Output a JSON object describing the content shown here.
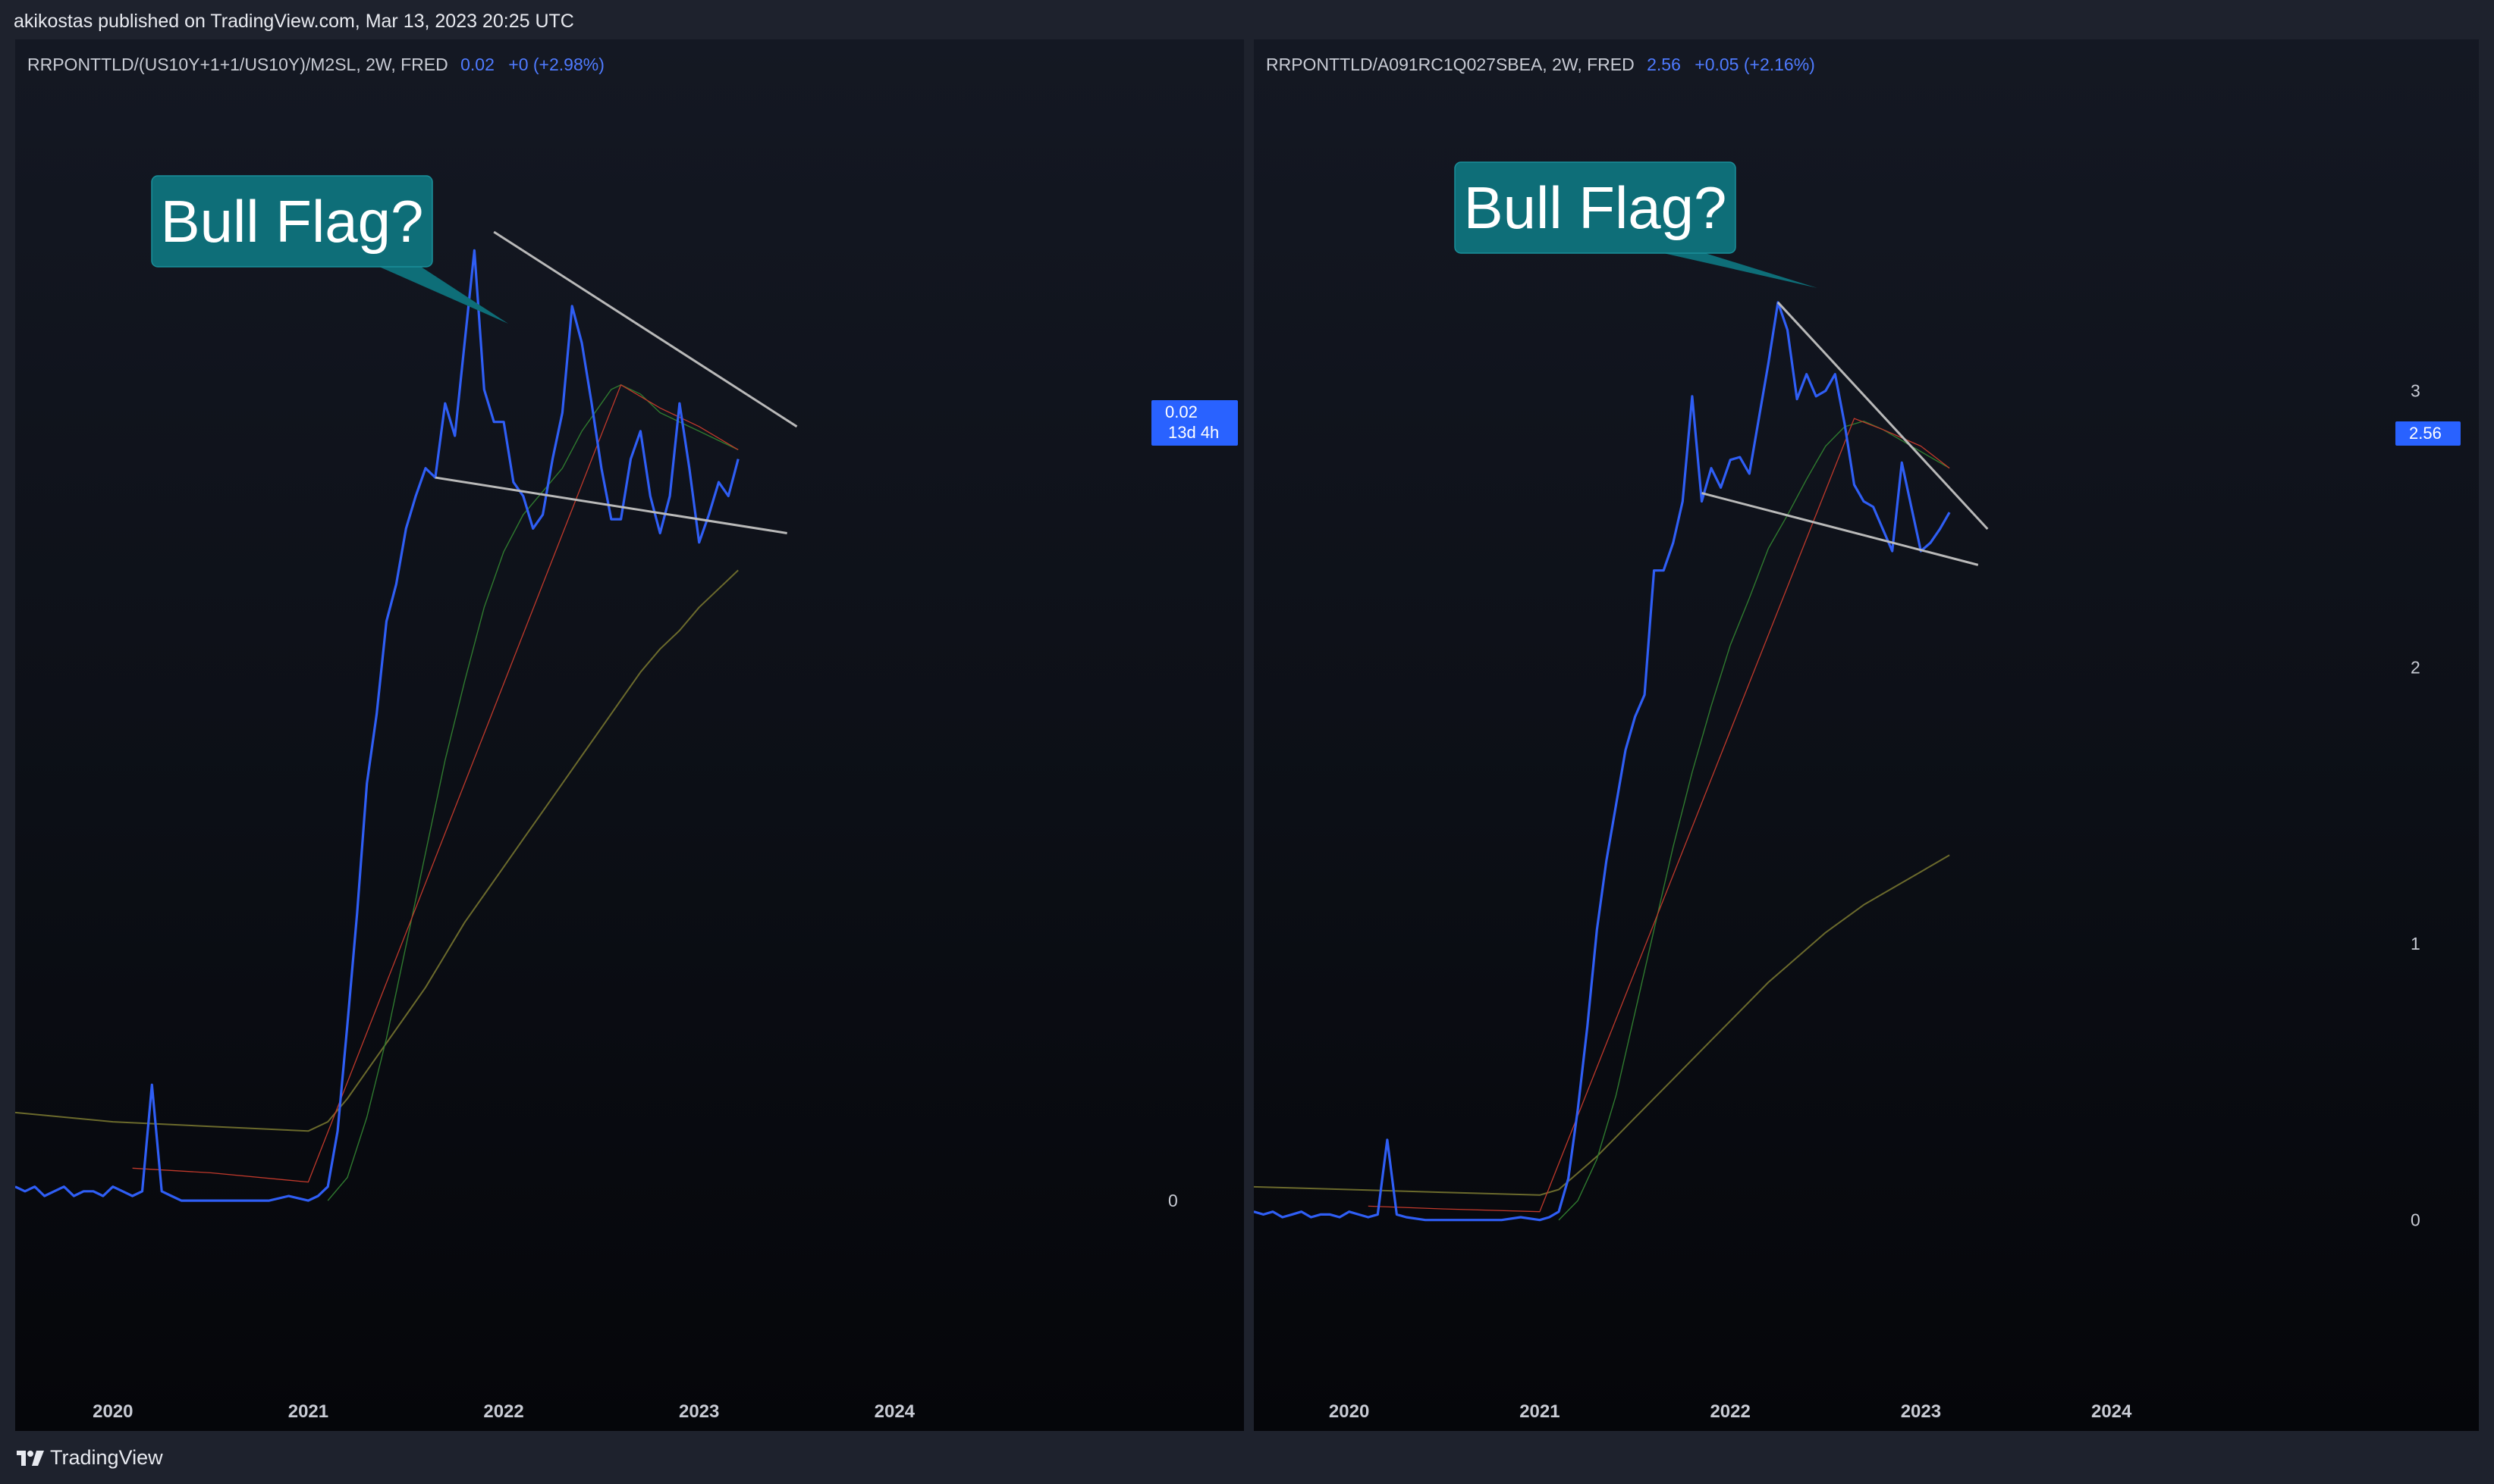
{
  "header": {
    "publisher": "akikostas published on TradingView.com, Mar 13, 2023 20:25 UTC"
  },
  "footer": {
    "brand": "TradingView",
    "icon": "tradingview-logo-icon"
  },
  "colors": {
    "price": "#2f5ef5",
    "ma_fast": "#2f7a2f",
    "ma_slow": "#6b6a2c",
    "ma_red": "#c0392b",
    "trendline": "#b9b9b9",
    "callout": "#0e6e78",
    "badge": "#2962ff"
  },
  "panes": [
    {
      "legend": {
        "symbol": "RRPONTTLD/(US10Y+1+1/US10Y)/M2SL, 2W, FRED",
        "value": "0.02",
        "change": "+0 (+2.98%)"
      },
      "callout": "Bull Flag?",
      "price_badge": {
        "value": "0.02",
        "countdown": "13d 4h"
      }
    },
    {
      "legend": {
        "symbol": "RRPONTTLD/A091RC1Q027SBEA, 2W, FRED",
        "value": "2.56",
        "change": "+0.05 (+2.16%)"
      },
      "callout": "Bull Flag?",
      "price_badge": {
        "value": "2.56"
      }
    }
  ],
  "chart_data": [
    {
      "type": "line",
      "title": "RRPONTTLD/(US10Y+1+1/US10Y)/M2SL, 2W, FRED",
      "x_ticks": [
        "2020",
        "2021",
        "2022",
        "2023",
        "2024"
      ],
      "y_ticks": [
        "0"
      ],
      "xlim": [
        2019.5,
        2025.4
      ],
      "ylim": [
        -0.0034,
        0.0226
      ],
      "series": [
        {
          "role": "price",
          "x": [
            2019.5,
            2019.55,
            2019.6,
            2019.65,
            2019.7,
            2019.75,
            2019.8,
            2019.85,
            2019.9,
            2019.95,
            2020.0,
            2020.05,
            2020.1,
            2020.15,
            2020.2,
            2020.25,
            2020.3,
            2020.35,
            2020.4,
            2020.5,
            2020.6,
            2020.7,
            2020.8,
            2020.9,
            2021.0,
            2021.05,
            2021.1,
            2021.15,
            2021.2,
            2021.25,
            2021.3,
            2021.35,
            2021.4,
            2021.45,
            2021.5,
            2021.55,
            2021.6,
            2021.65,
            2021.7,
            2021.75,
            2021.8,
            2021.85,
            2021.9,
            2021.95,
            2022.0,
            2022.05,
            2022.1,
            2022.15,
            2022.2,
            2022.25,
            2022.3,
            2022.35,
            2022.4,
            2022.45,
            2022.5,
            2022.55,
            2022.6,
            2022.65,
            2022.7,
            2022.75,
            2022.8,
            2022.85,
            2022.9,
            2022.95,
            2023.0,
            2023.05,
            2023.1,
            2023.15,
            2023.2
          ],
          "y": [
            0.0003,
            0.0002,
            0.0003,
            0.0001,
            0.0002,
            0.0003,
            0.0001,
            0.0002,
            0.0002,
            0.0001,
            0.0003,
            0.0002,
            0.0001,
            0.0002,
            0.0025,
            0.0002,
            0.0001,
            0.0,
            0.0,
            0.0,
            0.0,
            0.0,
            0.0,
            0.0001,
            0.0,
            0.0001,
            0.0003,
            0.0015,
            0.0038,
            0.0062,
            0.009,
            0.0105,
            0.0125,
            0.0133,
            0.0145,
            0.0152,
            0.0158,
            0.0156,
            0.0172,
            0.0165,
            0.0185,
            0.0205,
            0.0175,
            0.0168,
            0.0168,
            0.0155,
            0.0152,
            0.0145,
            0.0148,
            0.016,
            0.017,
            0.0193,
            0.0185,
            0.0172,
            0.0158,
            0.0147,
            0.0147,
            0.016,
            0.0166,
            0.0152,
            0.0144,
            0.0152,
            0.0172,
            0.0158,
            0.0142,
            0.0148,
            0.0155,
            0.0152,
            0.016
          ]
        },
        {
          "role": "ma_fast",
          "x": [
            2021.1,
            2021.2,
            2021.3,
            2021.4,
            2021.5,
            2021.6,
            2021.7,
            2021.8,
            2021.9,
            2022.0,
            2022.1,
            2022.2,
            2022.3,
            2022.4,
            2022.5,
            2022.55,
            2022.6,
            2022.7,
            2022.8,
            2022.9,
            2023.0,
            2023.1,
            2023.2
          ],
          "y": [
            0.0,
            0.0005,
            0.0018,
            0.0035,
            0.0055,
            0.0075,
            0.0095,
            0.0112,
            0.0128,
            0.014,
            0.0148,
            0.0153,
            0.0158,
            0.0166,
            0.0172,
            0.0175,
            0.0176,
            0.0174,
            0.017,
            0.0168,
            0.0166,
            0.0164,
            0.0162
          ]
        },
        {
          "role": "ma_slow",
          "x": [
            2019.5,
            2020.0,
            2020.5,
            2021.0,
            2021.1,
            2021.2,
            2021.3,
            2021.4,
            2021.5,
            2021.6,
            2021.7,
            2021.8,
            2021.9,
            2022.0,
            2022.1,
            2022.2,
            2022.3,
            2022.4,
            2022.5,
            2022.6,
            2022.7,
            2022.8,
            2022.9,
            2023.0,
            2023.1,
            2023.2
          ],
          "y": [
            0.0019,
            0.0017,
            0.0016,
            0.0015,
            0.0017,
            0.0022,
            0.0028,
            0.0034,
            0.004,
            0.0046,
            0.0053,
            0.006,
            0.0066,
            0.0072,
            0.0078,
            0.0084,
            0.009,
            0.0096,
            0.0102,
            0.0108,
            0.0114,
            0.0119,
            0.0123,
            0.0128,
            0.0132,
            0.0136
          ]
        },
        {
          "role": "ma_red",
          "x": [
            2020.1,
            2020.5,
            2021.0,
            2022.6,
            2022.8,
            2023.0,
            2023.2
          ],
          "y": [
            0.0007,
            0.0006,
            0.0004,
            0.0176,
            0.0171,
            0.0167,
            0.0162
          ]
        }
      ],
      "trendlines": [
        {
          "x": [
            2021.65,
            2023.45
          ],
          "y": [
            0.0156,
            0.0144
          ]
        },
        {
          "x": [
            2021.95,
            2023.5
          ],
          "y": [
            0.0209,
            0.0167
          ]
        }
      ]
    },
    {
      "type": "line",
      "title": "RRPONTTLD/A091RC1Q027SBEA, 2W, FRED",
      "x_ticks": [
        "2020",
        "2021",
        "2022",
        "2023",
        "2024"
      ],
      "y_ticks": [
        "0",
        "1",
        "2",
        "3"
      ],
      "xlim": [
        2019.5,
        2025.45
      ],
      "ylim": [
        -0.5,
        3.86
      ],
      "series": [
        {
          "role": "price",
          "x": [
            2019.5,
            2019.55,
            2019.6,
            2019.65,
            2019.7,
            2019.75,
            2019.8,
            2019.85,
            2019.9,
            2019.95,
            2020.0,
            2020.05,
            2020.1,
            2020.15,
            2020.2,
            2020.25,
            2020.3,
            2020.4,
            2020.5,
            2020.6,
            2020.7,
            2020.8,
            2020.9,
            2021.0,
            2021.05,
            2021.1,
            2021.15,
            2021.2,
            2021.25,
            2021.3,
            2021.35,
            2021.4,
            2021.45,
            2021.5,
            2021.55,
            2021.6,
            2021.65,
            2021.7,
            2021.75,
            2021.8,
            2021.85,
            2021.9,
            2021.95,
            2022.0,
            2022.05,
            2022.1,
            2022.15,
            2022.2,
            2022.25,
            2022.3,
            2022.35,
            2022.4,
            2022.45,
            2022.5,
            2022.55,
            2022.6,
            2022.65,
            2022.7,
            2022.75,
            2022.8,
            2022.85,
            2022.9,
            2022.95,
            2023.0,
            2023.05,
            2023.1,
            2023.15
          ],
          "y": [
            0.03,
            0.02,
            0.03,
            0.01,
            0.02,
            0.03,
            0.01,
            0.02,
            0.02,
            0.01,
            0.03,
            0.02,
            0.01,
            0.02,
            0.29,
            0.02,
            0.01,
            0.0,
            0.0,
            0.0,
            0.0,
            0.0,
            0.01,
            0.0,
            0.01,
            0.03,
            0.15,
            0.4,
            0.7,
            1.05,
            1.3,
            1.5,
            1.7,
            1.82,
            1.9,
            2.35,
            2.35,
            2.45,
            2.6,
            2.98,
            2.6,
            2.72,
            2.65,
            2.75,
            2.76,
            2.7,
            2.9,
            3.1,
            3.32,
            3.22,
            2.97,
            3.06,
            2.98,
            3.0,
            3.06,
            2.88,
            2.66,
            2.6,
            2.58,
            2.5,
            2.42,
            2.74,
            2.58,
            2.42,
            2.45,
            2.5,
            2.56
          ]
        },
        {
          "role": "ma_fast",
          "x": [
            2021.1,
            2021.2,
            2021.3,
            2021.4,
            2021.5,
            2021.6,
            2021.7,
            2021.8,
            2021.9,
            2022.0,
            2022.1,
            2022.2,
            2022.3,
            2022.4,
            2022.45,
            2022.5,
            2022.6,
            2022.7,
            2022.8,
            2022.9,
            2023.0,
            2023.1,
            2023.15
          ],
          "y": [
            0.0,
            0.07,
            0.22,
            0.45,
            0.75,
            1.05,
            1.35,
            1.62,
            1.86,
            2.08,
            2.25,
            2.43,
            2.55,
            2.68,
            2.74,
            2.8,
            2.87,
            2.89,
            2.86,
            2.82,
            2.78,
            2.74,
            2.72
          ]
        },
        {
          "role": "ma_slow",
          "x": [
            2019.5,
            2020.0,
            2020.5,
            2021.0,
            2021.1,
            2021.2,
            2021.3,
            2021.4,
            2021.5,
            2021.6,
            2021.7,
            2021.8,
            2021.9,
            2022.0,
            2022.1,
            2022.2,
            2022.3,
            2022.4,
            2022.5,
            2022.6,
            2022.7,
            2022.8,
            2022.9,
            2023.0,
            2023.1,
            2023.15
          ],
          "y": [
            0.12,
            0.11,
            0.1,
            0.09,
            0.11,
            0.17,
            0.23,
            0.3,
            0.37,
            0.44,
            0.51,
            0.58,
            0.65,
            0.72,
            0.79,
            0.86,
            0.92,
            0.98,
            1.04,
            1.09,
            1.14,
            1.18,
            1.22,
            1.26,
            1.3,
            1.32
          ]
        },
        {
          "role": "ma_red",
          "x": [
            2020.1,
            2020.5,
            2021.0,
            2022.65,
            2022.8,
            2023.0,
            2023.15
          ],
          "y": [
            0.05,
            0.04,
            0.03,
            2.9,
            2.86,
            2.8,
            2.72
          ]
        }
      ],
      "trendlines": [
        {
          "x": [
            2021.85,
            2023.3
          ],
          "y": [
            2.63,
            2.37
          ]
        },
        {
          "x": [
            2022.25,
            2023.35
          ],
          "y": [
            3.32,
            2.5
          ]
        }
      ]
    }
  ]
}
